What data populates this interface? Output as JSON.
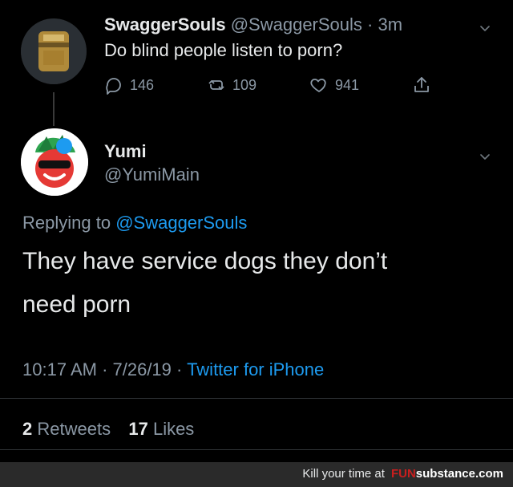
{
  "tweet1": {
    "author_name": "SwaggerSouls",
    "author_handle": "@SwaggerSouls",
    "time_ago": "3m",
    "text": "Do blind people listen to porn?",
    "reply_count": "146",
    "retweet_count": "109",
    "like_count": "941"
  },
  "tweet2": {
    "author_name": "Yumi",
    "author_handle": "@YumiMain",
    "replying_to_prefix": "Replying to",
    "replying_to_handle": "@SwaggerSouls",
    "text_line1": "They have service dogs they don’t",
    "text_line2": "need porn",
    "timestamp": "10:17 AM · 7/26/19 ·",
    "source": "Twitter for iPhone",
    "retweets_count": "2",
    "retweets_label": "Retweets",
    "likes_count": "17",
    "likes_label": "Likes"
  },
  "footer": {
    "text": "Kill your time at",
    "brand_left": "FUN",
    "brand_right": "substance.com"
  },
  "colors": {
    "accent": "#1d9bf0",
    "background": "#000000",
    "muted": "#8b98a5",
    "brand_red": "#c81e1e"
  }
}
